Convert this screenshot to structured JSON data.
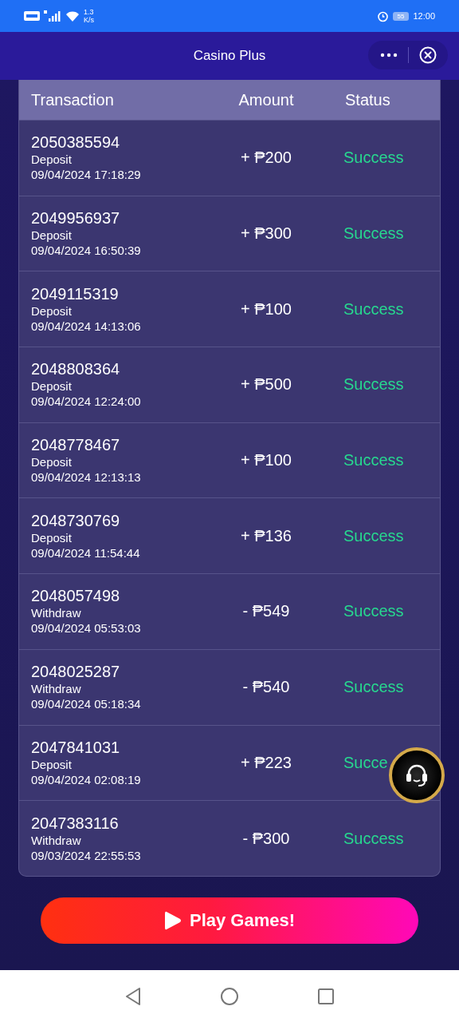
{
  "status_bar": {
    "speed": "1.3",
    "speed_unit": "K/s",
    "battery": "55",
    "time": "12:00"
  },
  "header": {
    "title": "Casino Plus"
  },
  "table": {
    "columns": [
      "Transaction",
      "Amount",
      "Status"
    ],
    "rows": [
      {
        "id": "2050385594",
        "type": "Deposit",
        "date": "09/04/2024 17:18:29",
        "amount": "+ ₱200",
        "status": "Success"
      },
      {
        "id": "2049956937",
        "type": "Deposit",
        "date": "09/04/2024 16:50:39",
        "amount": "+ ₱300",
        "status": "Success"
      },
      {
        "id": "2049115319",
        "type": "Deposit",
        "date": "09/04/2024 14:13:06",
        "amount": "+ ₱100",
        "status": "Success"
      },
      {
        "id": "2048808364",
        "type": "Deposit",
        "date": "09/04/2024 12:24:00",
        "amount": "+ ₱500",
        "status": "Success"
      },
      {
        "id": "2048778467",
        "type": "Deposit",
        "date": "09/04/2024 12:13:13",
        "amount": "+ ₱100",
        "status": "Success"
      },
      {
        "id": "2048730769",
        "type": "Deposit",
        "date": "09/04/2024 11:54:44",
        "amount": "+ ₱136",
        "status": "Success"
      },
      {
        "id": "2048057498",
        "type": "Withdraw",
        "date": "09/04/2024 05:53:03",
        "amount": "- ₱549",
        "status": "Success"
      },
      {
        "id": "2048025287",
        "type": "Withdraw",
        "date": "09/04/2024 05:18:34",
        "amount": "- ₱540",
        "status": "Success"
      },
      {
        "id": "2047841031",
        "type": "Deposit",
        "date": "09/04/2024 02:08:19",
        "amount": "+ ₱223",
        "status": "Succe"
      },
      {
        "id": "2047383116",
        "type": "Withdraw",
        "date": "09/03/2024 22:55:53",
        "amount": "- ₱300",
        "status": "Success"
      }
    ]
  },
  "play_button": {
    "label": "Play Games!"
  }
}
